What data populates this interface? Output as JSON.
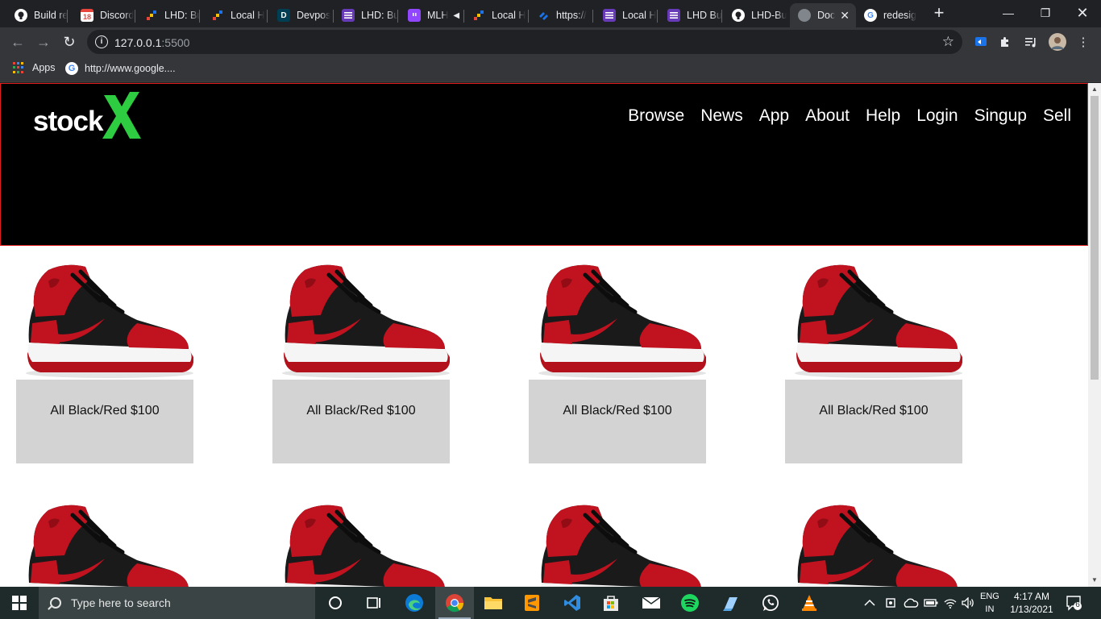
{
  "browser": {
    "tabs": [
      {
        "title": "Build re",
        "favicon": "github-shield-icon",
        "color": "#e8eaed"
      },
      {
        "title": "Discord",
        "favicon": "calendar-icon",
        "badge": "18",
        "color": "#e8453c"
      },
      {
        "title": "LHD: Bu",
        "favicon": "mlh-icon",
        "color": "#e8453c"
      },
      {
        "title": "Local H",
        "favicon": "mlh-icon",
        "color": "#e8453c"
      },
      {
        "title": "Devpos",
        "favicon": "devpost-icon",
        "letter": "D",
        "color": "#003e54"
      },
      {
        "title": "LHD: Bu",
        "favicon": "forms-icon",
        "color": "#673ab7"
      },
      {
        "title": "MLH",
        "favicon": "twitch-icon",
        "color": "#9146ff"
      },
      {
        "title": "Local H",
        "favicon": "mlh-icon",
        "color": "#e8453c"
      },
      {
        "title": "https://",
        "favicon": "link-icon",
        "color": "#1a73e8"
      },
      {
        "title": "Local H",
        "favicon": "forms-icon",
        "color": "#673ab7"
      },
      {
        "title": "LHD Bu",
        "favicon": "forms-icon",
        "color": "#673ab7"
      },
      {
        "title": "LHD-Bu",
        "favicon": "github-icon",
        "color": "#ffffff"
      },
      {
        "title": "Doc",
        "favicon": "globe-icon",
        "color": "#80868b"
      },
      {
        "title": "redesig",
        "favicon": "google-icon",
        "color": "#ffffff"
      }
    ],
    "url_host": "127.0.0.1",
    "url_port": ":5500",
    "bookmarks": [
      {
        "label": "Apps"
      },
      {
        "label": "http://www.google...."
      }
    ]
  },
  "site": {
    "logo_word": "stock",
    "logo_mark": "X",
    "brand_green": "#2ecc40",
    "nav": [
      "Browse",
      "News",
      "App",
      "About",
      "Help",
      "Login",
      "Singup",
      "Sell"
    ],
    "products": [
      {
        "caption": "All Black/Red $100"
      },
      {
        "caption": "All Black/Red $100"
      },
      {
        "caption": "All Black/Red $100"
      },
      {
        "caption": "All Black/Red $100"
      },
      {
        "caption": ""
      },
      {
        "caption": ""
      },
      {
        "caption": ""
      },
      {
        "caption": ""
      }
    ]
  },
  "taskbar": {
    "search_placeholder": "Type here to search",
    "lang_top": "ENG",
    "lang_bottom": "IN",
    "time": "4:17 AM",
    "date": "1/13/2021",
    "notifications": "6",
    "apps": [
      "task-view-icon",
      "edge-icon",
      "chrome-icon",
      "file-explorer-icon",
      "sublime-icon",
      "vscode-icon",
      "store-icon",
      "mail-icon",
      "spotify-icon",
      "notepad-icon",
      "whatsapp-icon",
      "vlc-icon"
    ]
  }
}
